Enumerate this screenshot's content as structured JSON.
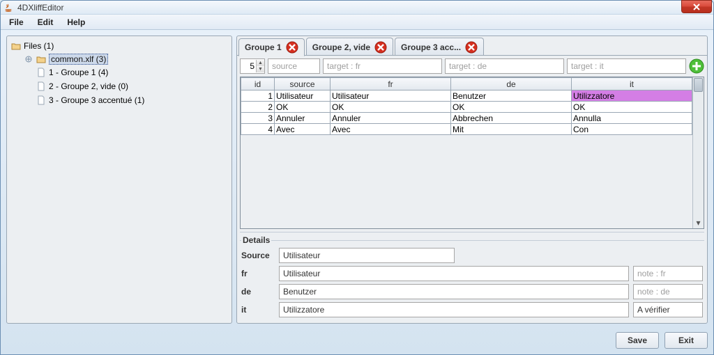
{
  "window": {
    "title": "4DXliffEditor"
  },
  "menubar": {
    "file": "File",
    "edit": "Edit",
    "help": "Help"
  },
  "tree": {
    "root": "Files (1)",
    "file": "common.xlf (3)",
    "items": [
      "1 - Groupe 1 (4)",
      "2 - Groupe 2, vide (0)",
      "3 - Groupe 3 accentué (1)"
    ]
  },
  "tabs": [
    {
      "label": "Groupe 1"
    },
    {
      "label": "Groupe 2, vide"
    },
    {
      "label": "Groupe 3 acc..."
    }
  ],
  "filters": {
    "spinner": "5",
    "source_ph": "source",
    "fr_ph": "target : fr",
    "de_ph": "target : de",
    "it_ph": "target : it"
  },
  "table": {
    "headers": {
      "id": "id",
      "source": "source",
      "fr": "fr",
      "de": "de",
      "it": "it"
    },
    "rows": [
      {
        "id": "1",
        "source": "Utilisateur",
        "fr": "Utilisateur",
        "de": "Benutzer",
        "it": "Utilizzatore"
      },
      {
        "id": "2",
        "source": "OK",
        "fr": "OK",
        "de": "OK",
        "it": "OK"
      },
      {
        "id": "3",
        "source": "Annuler",
        "fr": "Annuler",
        "de": "Abbrechen",
        "it": "Annulla"
      },
      {
        "id": "4",
        "source": "Avec",
        "fr": "Avec",
        "de": "Mit",
        "it": "Con"
      }
    ]
  },
  "details": {
    "legend": "Details",
    "source_label": "Source",
    "fr_label": "fr",
    "de_label": "de",
    "it_label": "it",
    "source_value": "Utilisateur",
    "fr_value": "Utilisateur",
    "de_value": "Benutzer",
    "it_value": "Utilizzatore",
    "note_fr_ph": "note : fr",
    "note_de_ph": "note : de",
    "note_it_value": "A vérifier"
  },
  "buttons": {
    "save": "Save",
    "exit": "Exit"
  }
}
